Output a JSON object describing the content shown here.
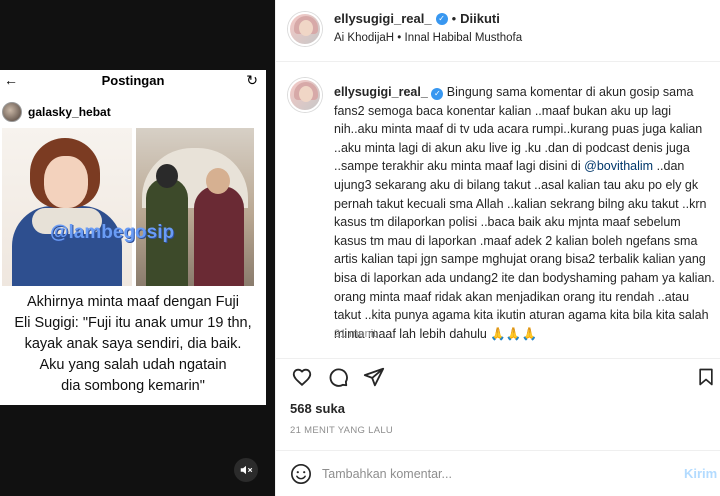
{
  "media": {
    "screenshot": {
      "header_title": "Postingan",
      "username": "galasky_hebat",
      "photo_left_watermark": "@lambegosip",
      "photo_right_banner": "",
      "caption_lines": [
        "Akhirnya minta maaf dengan Fuji",
        "Eli Sugigi: \"Fuji itu anak umur 19 thn,",
        "kayak anak saya sendiri, dia baik.",
        "Aku yang salah udah ngatain",
        "dia sombong kemarin\""
      ]
    },
    "mute_icon": "speaker-muted-icon"
  },
  "header": {
    "username": "ellysugigi_real_",
    "separator": "•",
    "follow_state": "Diikuti",
    "music": "Ai KhodijaH • Innal Habibal Musthofa"
  },
  "comment": {
    "username": "ellysugigi_real_",
    "text_before_mention": "Bingung sama komentar di akun gosip sama fans2 semoga baca konentar kalian ..maaf bukan aku up lagi nih..aku minta maaf di tv uda acara rumpi..kurang puas juga kalian ..aku minta lagi di akun aku live ig .ku .dan di podcast denis juga ..sampe terakhir aku minta maaf lagi disini di ",
    "mention": "@bovithalim",
    "text_after_mention": " ..dan ujung3 sekarang aku di bilang takut ..asal kalian tau aku po ely gk pernah takut kecuali sma Allah ..kalian sekrang bilng aku takut ..krn kasus tm dilaporkan polisi ..baca baik aku mjnta maaf sebelum kasus tm mau di laporkan .maaf adek 2 kalian boleh ngefans sma artis kalian tapi jgn sampe mghujat orang bisa2 terbalik kalian yang bisa di laporkan ada undang2 ite dan bodyshaming paham ya kalian. orang minta maaf ridak akan menjadikan orang itu rendah ..atau takut ..kita punya agama kita ikutin aturan agama kita bila kita salah minta maaf lah lebih dahulu 🙏🙏🙏",
    "time": "21 menit"
  },
  "actions": {
    "like_icon": "heart-icon",
    "comment_icon": "comment-bubble-icon",
    "share_icon": "paper-plane-icon",
    "save_icon": "bookmark-icon"
  },
  "likes": "568 suka",
  "post_date": "21 MENIT YANG LALU",
  "add_comment": {
    "emoji_icon": "smiley-icon",
    "placeholder": "Tambahkan komentar...",
    "send_label": "Kirim"
  },
  "colors": {
    "link_blue": "#00376b",
    "verified_blue": "#3897f0",
    "send_disabled": "#b3dbff",
    "muted_text": "#8e8e8e"
  }
}
